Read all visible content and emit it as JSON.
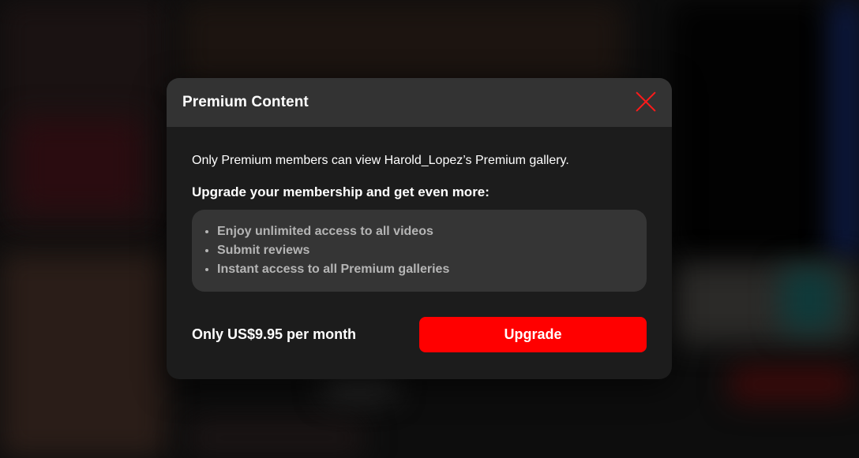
{
  "modal": {
    "title": "Premium Content",
    "close_icon": "close-icon",
    "intro": "Only Premium members can view Harold_Lopez’s Premium gallery.",
    "subheading": "Upgrade your membership and get even more:",
    "benefits": [
      "Enjoy unlimited access to all videos",
      "Submit reviews",
      "Instant access to all Premium galleries"
    ],
    "price_text": "Only US$9.95 per month",
    "upgrade_label": "Upgrade"
  },
  "colors": {
    "accent": "#ff0000",
    "header_bg": "#333333",
    "modal_bg": "#1c1c1c",
    "benefits_bg": "#353535",
    "benefit_text": "#b5b5b5"
  }
}
